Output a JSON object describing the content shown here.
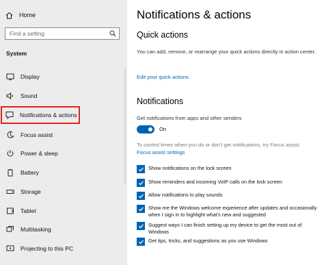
{
  "sidebar": {
    "home_label": "Home",
    "search_placeholder": "Find a setting",
    "section_label": "System",
    "items": [
      {
        "label": "Display",
        "icon": "display-icon"
      },
      {
        "label": "Sound",
        "icon": "sound-icon"
      },
      {
        "label": "Notifications & actions",
        "icon": "notifications-icon",
        "selected": true
      },
      {
        "label": "Focus assist",
        "icon": "focus-assist-icon"
      },
      {
        "label": "Power & sleep",
        "icon": "power-icon"
      },
      {
        "label": "Battery",
        "icon": "battery-icon"
      },
      {
        "label": "Storage",
        "icon": "storage-icon"
      },
      {
        "label": "Tablet",
        "icon": "tablet-icon"
      },
      {
        "label": "Multitasking",
        "icon": "multitasking-icon"
      },
      {
        "label": "Projecting to this PC",
        "icon": "projecting-icon"
      }
    ]
  },
  "main": {
    "title": "Notifications & actions",
    "quick_actions": {
      "heading": "Quick actions",
      "description": "You can add, remove, or rearrange your quick actions directly in action center.",
      "edit_link": "Edit your quick actions"
    },
    "notifications": {
      "heading": "Notifications",
      "toggle_caption": "Get notifications from apps and other senders",
      "toggle_state": "On",
      "focus_hint": "To control times when you do or don't get notifications, try Focus assist.",
      "focus_link": "Focus assist settings",
      "options": [
        {
          "label": "Show notifications on the lock screen",
          "checked": true
        },
        {
          "label": "Show reminders and incoming VoIP calls on the lock screen",
          "checked": true
        },
        {
          "label": "Allow notifications to play sounds",
          "checked": true
        },
        {
          "label": "Show me the Windows welcome experience after updates and occasionally when I sign in to highlight what's new and suggested",
          "checked": true
        },
        {
          "label": "Suggest ways I can finish setting up my device to get the most out of Windows",
          "checked": true
        },
        {
          "label": "Get tips, tricks, and suggestions as you use Windows",
          "checked": true
        }
      ]
    }
  },
  "colors": {
    "accent": "#0063b1",
    "highlight_box": "#e0201f",
    "sidebar_bg": "#ececec"
  }
}
